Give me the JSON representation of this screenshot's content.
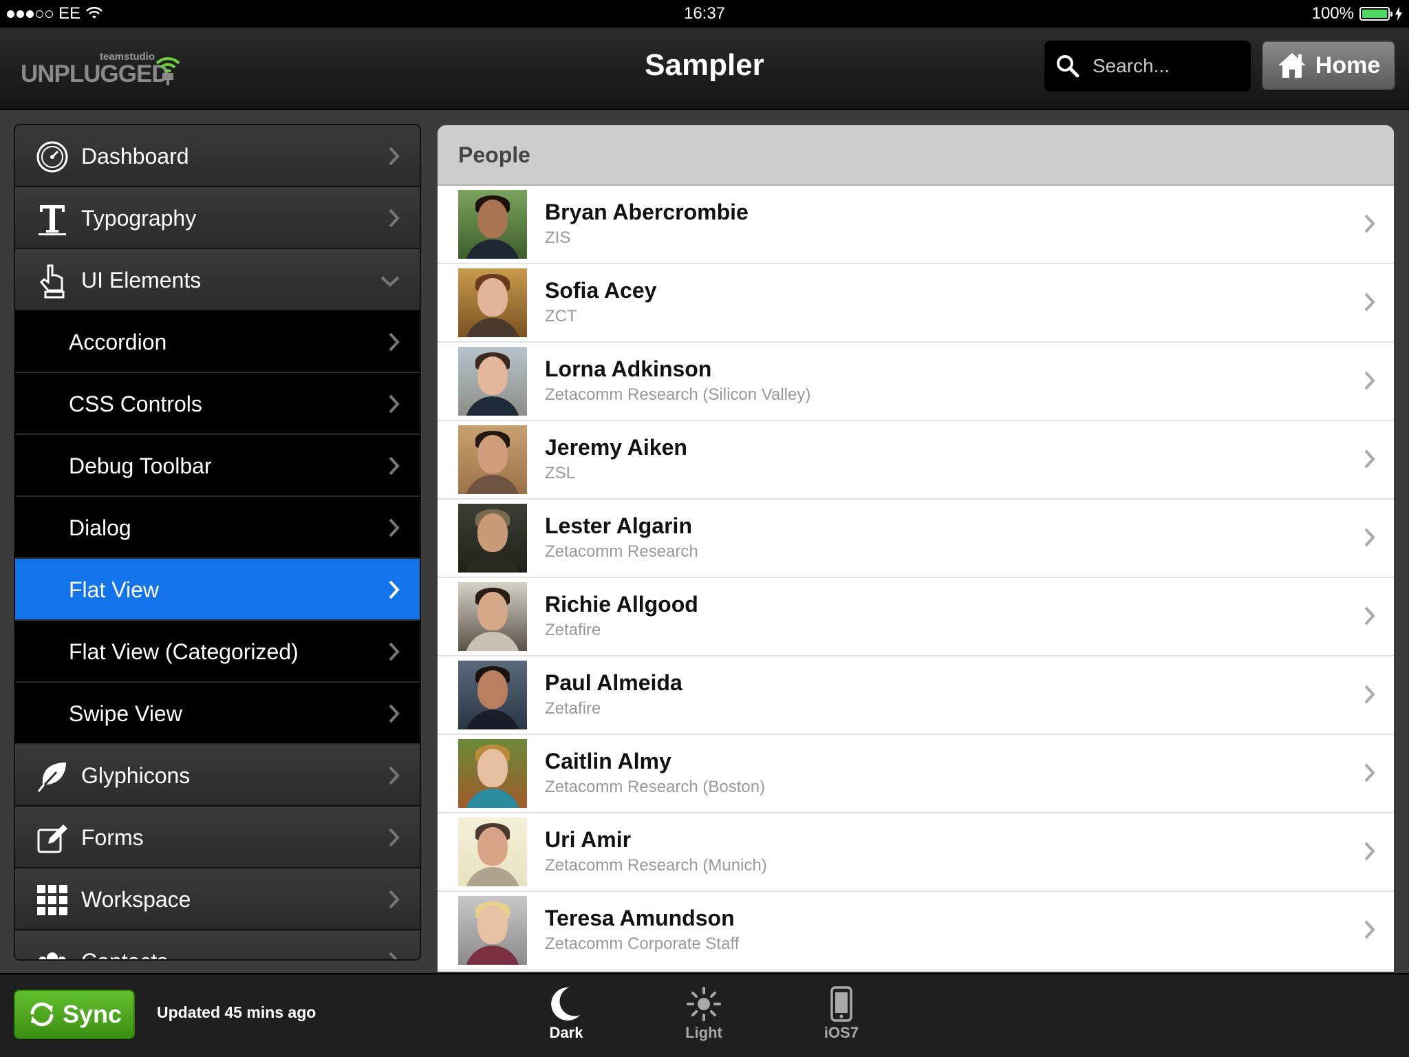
{
  "status_bar": {
    "carrier": "EE",
    "time": "16:37",
    "battery": "100%",
    "battery_level": 1.0
  },
  "header": {
    "logo_small": "teamstudio",
    "logo_big": "UNPLUGGED",
    "title": "Sampler",
    "search_placeholder": "Search...",
    "home_label": "Home"
  },
  "sidebar": {
    "items": [
      {
        "label": "Dashboard",
        "icon": "dashboard-icon",
        "type": "top"
      },
      {
        "label": "Typography",
        "icon": "typography-icon",
        "type": "top"
      },
      {
        "label": "UI Elements",
        "icon": "hand-pointer-icon",
        "type": "top",
        "expanded": true
      },
      {
        "label": "Accordion",
        "type": "child"
      },
      {
        "label": "CSS Controls",
        "type": "child"
      },
      {
        "label": "Debug Toolbar",
        "type": "child"
      },
      {
        "label": "Dialog",
        "type": "child"
      },
      {
        "label": "Flat View",
        "type": "child",
        "active": true
      },
      {
        "label": "Flat View (Categorized)",
        "type": "child"
      },
      {
        "label": "Swipe View",
        "type": "child"
      },
      {
        "label": "Glyphicons",
        "icon": "leaf-icon",
        "type": "top"
      },
      {
        "label": "Forms",
        "icon": "edit-icon",
        "type": "top"
      },
      {
        "label": "Workspace",
        "icon": "grid-icon",
        "type": "top"
      },
      {
        "label": "Contacts",
        "icon": "people-icon",
        "type": "top"
      }
    ]
  },
  "list": {
    "header": "People",
    "people": [
      {
        "name": "Bryan Abercrombie",
        "org": "ZIS"
      },
      {
        "name": "Sofia Acey",
        "org": "ZCT"
      },
      {
        "name": "Lorna Adkinson",
        "org": "Zetacomm Research (Silicon Valley)"
      },
      {
        "name": "Jeremy Aiken",
        "org": "ZSL"
      },
      {
        "name": "Lester Algarin",
        "org": "Zetacomm Research"
      },
      {
        "name": "Richie Allgood",
        "org": "Zetafire"
      },
      {
        "name": "Paul Almeida",
        "org": "Zetafire"
      },
      {
        "name": "Caitlin Almy",
        "org": "Zetacomm Research (Boston)"
      },
      {
        "name": "Uri Amir",
        "org": "Zetacomm Research (Munich)"
      },
      {
        "name": "Teresa Amundson",
        "org": "Zetacomm Corporate Staff"
      }
    ]
  },
  "footer": {
    "sync_label": "Sync",
    "updated": "Updated 45 mins ago",
    "themes": {
      "dark": "Dark",
      "light": "Light",
      "ios7": "iOS7"
    }
  },
  "colors": {
    "accent": "#1273ea",
    "sync_green": "#4ea81e",
    "battery_green": "#4cd964"
  }
}
